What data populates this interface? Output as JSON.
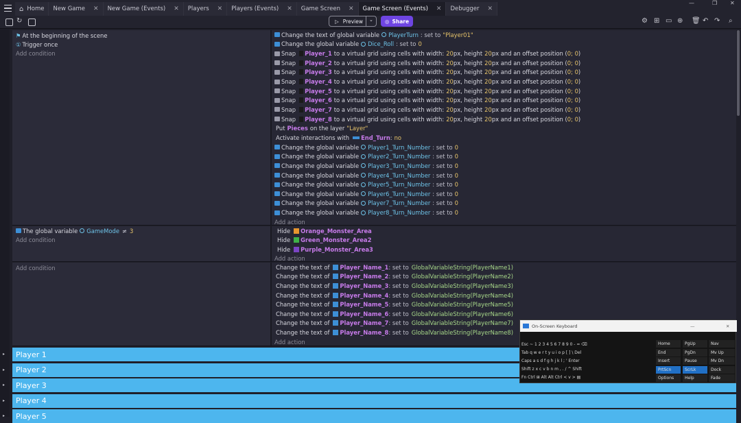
{
  "tabs": [
    {
      "label": "Home"
    },
    {
      "label": "New Game"
    },
    {
      "label": "New Game (Events)"
    },
    {
      "label": "Players"
    },
    {
      "label": "Players (Events)"
    },
    {
      "label": "Game Screen"
    },
    {
      "label": "Game Screen (Events)"
    },
    {
      "label": "Debugger"
    }
  ],
  "toolbar": {
    "preview_label": "Preview",
    "share_label": "Share"
  },
  "event1": {
    "conditions": [
      "At the beginning of the scene",
      "Trigger once"
    ],
    "add_condition": "Add condition",
    "add_action": "Add action",
    "actions": {
      "a0": {
        "pre": "Change the text of global variable",
        "var": "PlayerTurn",
        "mid": ": set to",
        "val": "\"Player01\""
      },
      "a1": {
        "pre": "Change the global variable",
        "var": "Dice_Roll",
        "mid": ": set to",
        "val": "0"
      },
      "snap_prefix": "Snap",
      "snap_suffix1": "to a virtual grid using cells with width:",
      "snap_w": "20",
      "snap_suffix2": "px, height",
      "snap_h": "20",
      "snap_suffix3": "px and an offset position (",
      "snap_off": "0; 0",
      "snap_end": ")",
      "snap_objects": [
        "Player_1",
        "Player_2",
        "Player_3",
        "Player_4",
        "Player_5",
        "Player_6",
        "Player_7",
        "Player_8"
      ],
      "put": {
        "pre": "Put",
        "obj": "Pieces",
        "mid": "on the layer",
        "val": "\"Layer\""
      },
      "activate": {
        "pre": "Activate interactions with",
        "obj": "End_Turn",
        "mid": ":",
        "val": "no"
      },
      "turn_prefix": "Change the global variable",
      "turn_mid": ": set to",
      "turn_val": "0",
      "turn_vars": [
        "Player1_Turn_Number",
        "Player2_Turn_Number",
        "Player3_Turn_Number",
        "Player4_Turn_Number",
        "Player5_Turn_Number",
        "Player6_Turn_Number",
        "Player7_Turn_Number",
        "Player8_Turn_Number"
      ]
    }
  },
  "event2": {
    "condition": {
      "pre": "The global variable",
      "var": "GameMode",
      "op": "≠",
      "val": "3"
    },
    "add_condition": "Add condition",
    "add_action": "Add action",
    "hide_label": "Hide",
    "hides": [
      {
        "obj": "Orange_Monster_Area",
        "color": "#e8962e"
      },
      {
        "obj": "Green_Monster_Area2",
        "color": "#3fb24a"
      },
      {
        "obj": "Purple_Monster_Area3",
        "color": "#7b45c4"
      }
    ]
  },
  "event3": {
    "add_condition": "Add condition",
    "add_action": "Add action",
    "text_pre": "Change the text of",
    "text_mid": ": set to",
    "rows": [
      {
        "obj": "Player_Name_1",
        "expr": "GlobalVariableString(PlayerName1)"
      },
      {
        "obj": "Player_Name_2",
        "expr": "GlobalVariableString(PlayerName2)"
      },
      {
        "obj": "Player_Name_3",
        "expr": "GlobalVariableString(PlayerName3)"
      },
      {
        "obj": "Player_Name_4",
        "expr": "GlobalVariableString(PlayerName4)"
      },
      {
        "obj": "Player_Name_5",
        "expr": "GlobalVariableString(PlayerName5)"
      },
      {
        "obj": "Player_Name_6",
        "expr": "GlobalVariableString(PlayerName6)"
      },
      {
        "obj": "Player_Name_7",
        "expr": "GlobalVariableString(PlayerName7)"
      },
      {
        "obj": "Player_Name_8",
        "expr": "GlobalVariableString(PlayerName8)"
      }
    ]
  },
  "groups": [
    "Player 1",
    "Player 2",
    "Player 3",
    "Player 4",
    "Player 5"
  ],
  "osk": {
    "title": "On-Screen Keyboard",
    "row1": "Esc  ~  1  2  3  4  5  6  7  8  9  0  -  =  ⌫",
    "row2": "Tab  q  w  e  r  t  y  u  i  o  p  [  ]  \\  Del",
    "row3": "Caps  a  s  d  f  g  h  j  k  l  ;  '  Enter",
    "row4": "Shift  z  x  c  v  b  n  m  ,  .  /  ^  Shift",
    "row5": "Fn  Ctrl  ⊞  Alt                    Alt  Ctrl  <  v  >  ▤",
    "keys": [
      [
        "Home",
        "PgUp",
        "Nav"
      ],
      [
        "End",
        "PgDn",
        "Mv Up"
      ],
      [
        "Insert",
        "Pause",
        "Mv Dn"
      ],
      [
        "PrtScn",
        "ScrLk",
        "Dock"
      ],
      [
        "Options",
        "Help",
        "Fade"
      ]
    ]
  }
}
